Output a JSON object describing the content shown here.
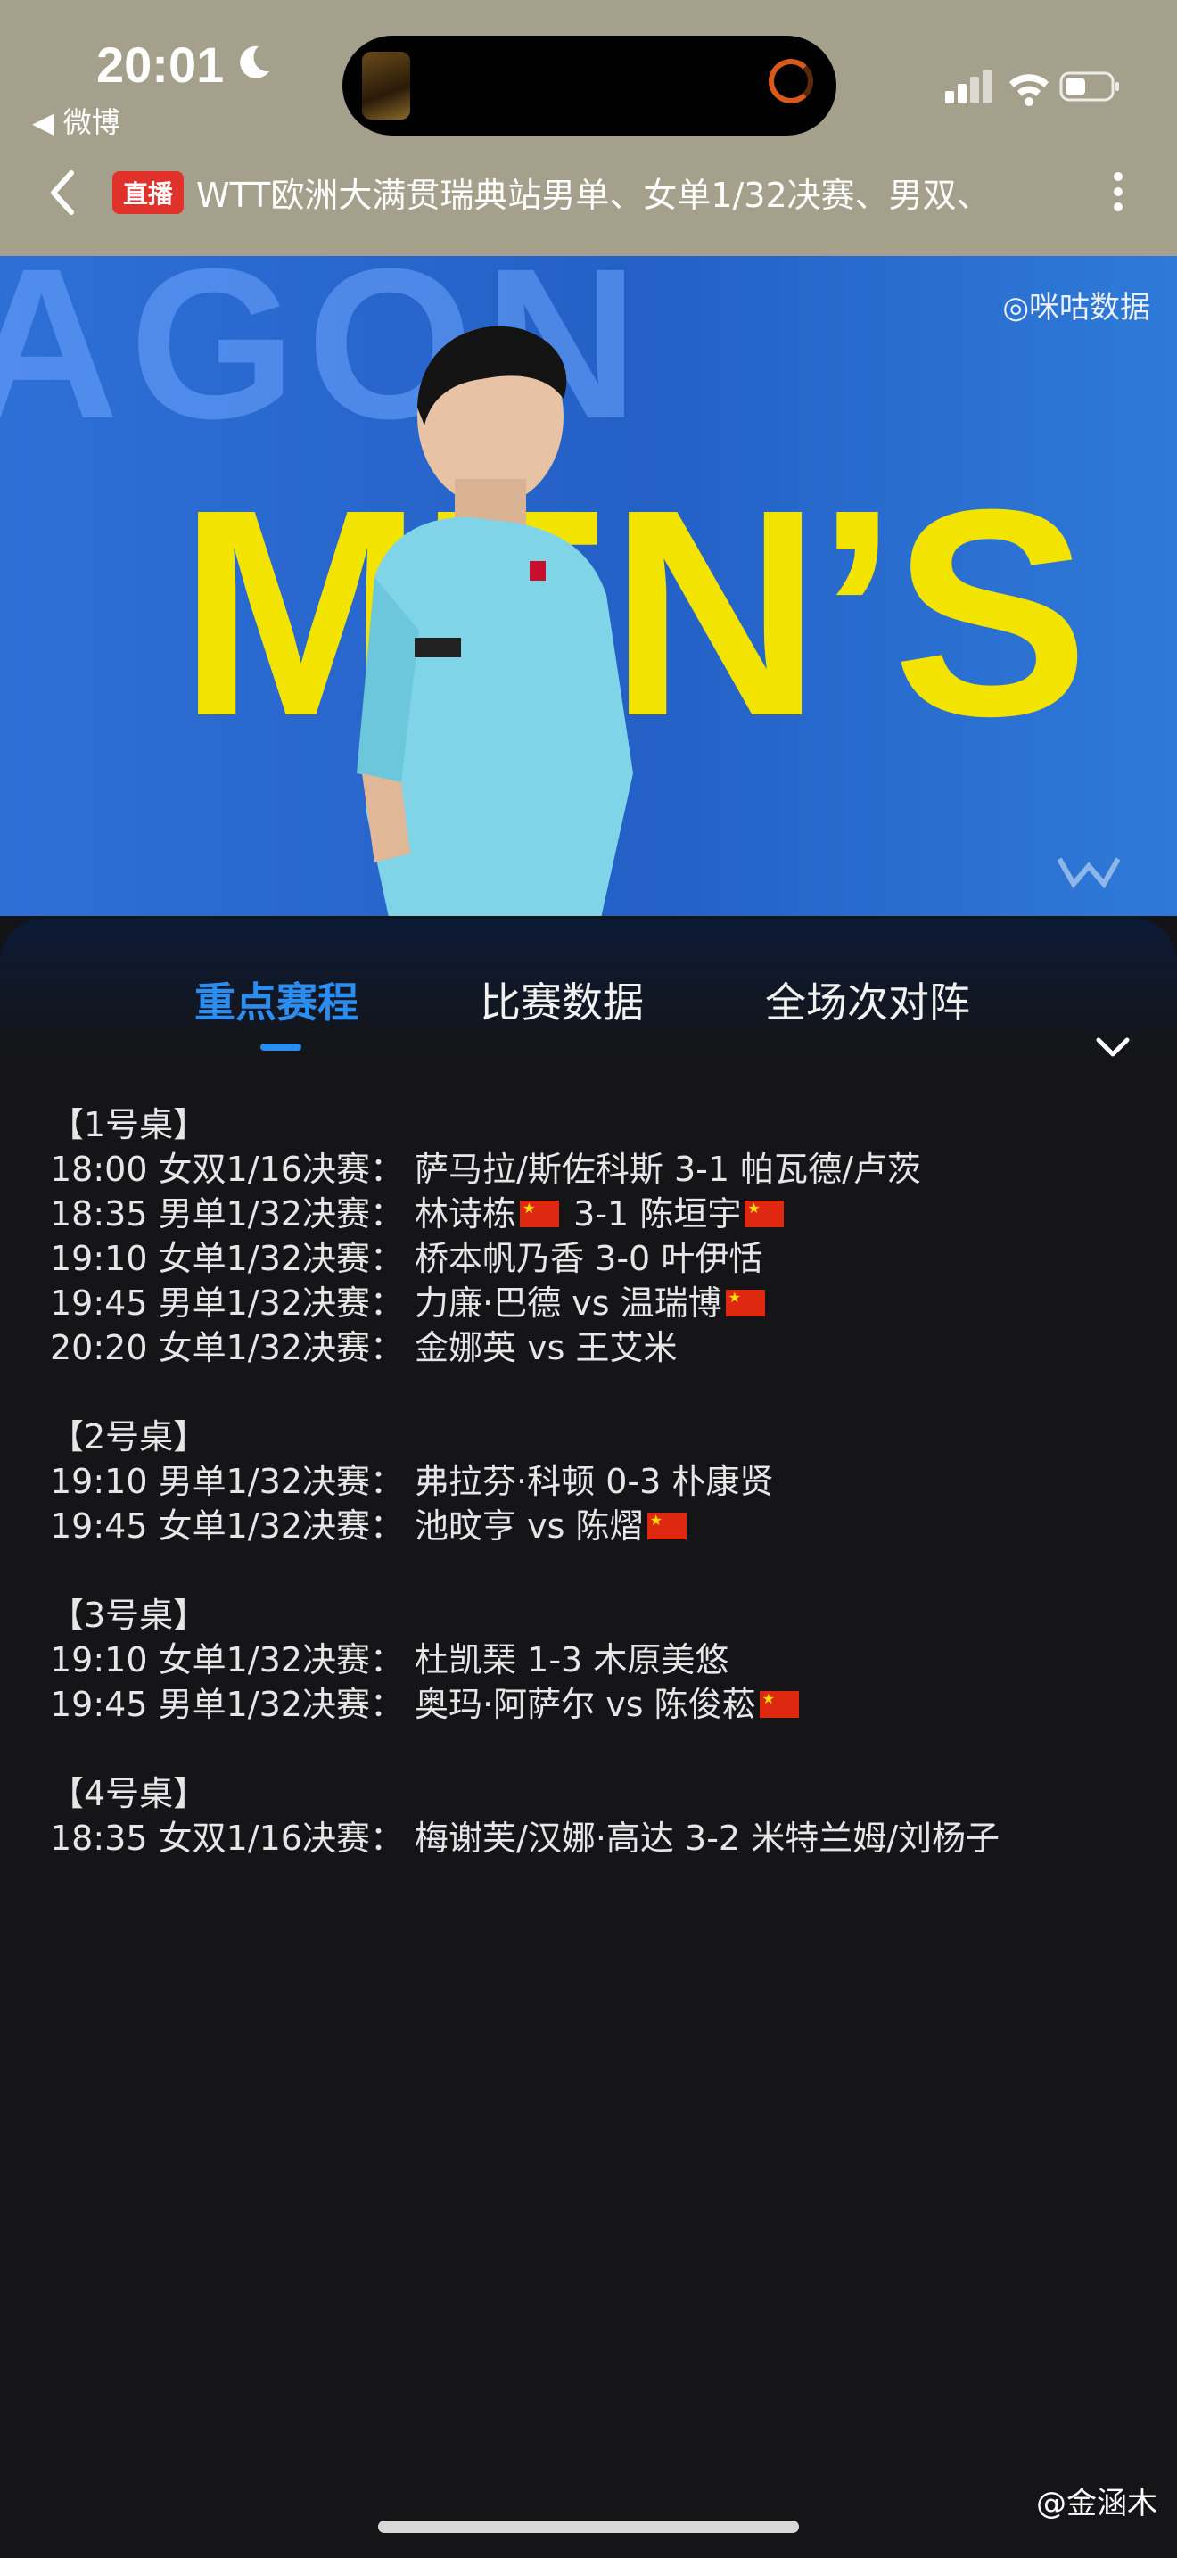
{
  "status_bar": {
    "time": "20:01",
    "back_app": "◀ 微博"
  },
  "header": {
    "live_badge": "直播",
    "title": "WTT欧洲大满贯瑞典站男单、女单1/32决赛、男双、"
  },
  "video": {
    "background_text": "AGON",
    "banner_text": "MEN’S",
    "watermark": "◎咪咕数据"
  },
  "tabs": [
    {
      "label": "重点赛程",
      "active": true
    },
    {
      "label": "比赛数据",
      "active": false
    },
    {
      "label": "全场次对阵",
      "active": false
    }
  ],
  "schedule": [
    {
      "table": "【1号桌】",
      "matches": [
        {
          "time": "18:00",
          "event": "女双1/16决赛：",
          "a": "萨马拉/斯佐科斯",
          "score": "3-1",
          "b": "帕瓦德/卢茨",
          "a_flag": false,
          "b_flag": false
        },
        {
          "time": "18:35",
          "event": "男单1/32决赛：",
          "a": "林诗栋",
          "score": "3-1",
          "b": "陈垣宇",
          "a_flag": true,
          "b_flag": true
        },
        {
          "time": "19:10",
          "event": "女单1/32决赛：",
          "a": "桥本帆乃香",
          "score": "3-0",
          "b": "叶伊恬",
          "a_flag": false,
          "b_flag": false
        },
        {
          "time": "19:45",
          "event": "男单1/32决赛：",
          "a": "力廉·巴德",
          "score": "vs",
          "b": "温瑞博",
          "a_flag": false,
          "b_flag": true
        },
        {
          "time": "20:20",
          "event": "女单1/32决赛：",
          "a": "金娜英",
          "score": "vs",
          "b": "王艾米",
          "a_flag": false,
          "b_flag": false
        }
      ]
    },
    {
      "table": "【2号桌】",
      "matches": [
        {
          "time": "19:10",
          "event": "男单1/32决赛：",
          "a": "弗拉芬·科顿",
          "score": "0-3",
          "b": "朴康贤",
          "a_flag": false,
          "b_flag": false
        },
        {
          "time": "19:45",
          "event": "女单1/32决赛：",
          "a": "池旼亨",
          "score": "vs",
          "b": "陈熠",
          "a_flag": false,
          "b_flag": true
        }
      ]
    },
    {
      "table": "【3号桌】",
      "matches": [
        {
          "time": "19:10",
          "event": "女单1/32决赛：",
          "a": "杜凯琹",
          "score": "1-3",
          "b": "木原美悠",
          "a_flag": false,
          "b_flag": false
        },
        {
          "time": "19:45",
          "event": "男单1/32决赛：",
          "a": "奥玛·阿萨尔",
          "score": "vs",
          "b": "陈俊菘",
          "a_flag": false,
          "b_flag": true
        }
      ]
    },
    {
      "table": "【4号桌】",
      "matches": [
        {
          "time": "18:35",
          "event": "女双1/16决赛：",
          "a": "梅谢芙/汉娜·高达",
          "score": "3-2",
          "b": "米特兰姆/刘杨子",
          "a_flag": false,
          "b_flag": false
        }
      ]
    }
  ],
  "credit": "@金涵木",
  "colors": {
    "accent": "#2c8df0",
    "live_red": "#e0322a",
    "header_bg": "#a5a08c",
    "panel_bg": "#151517"
  }
}
